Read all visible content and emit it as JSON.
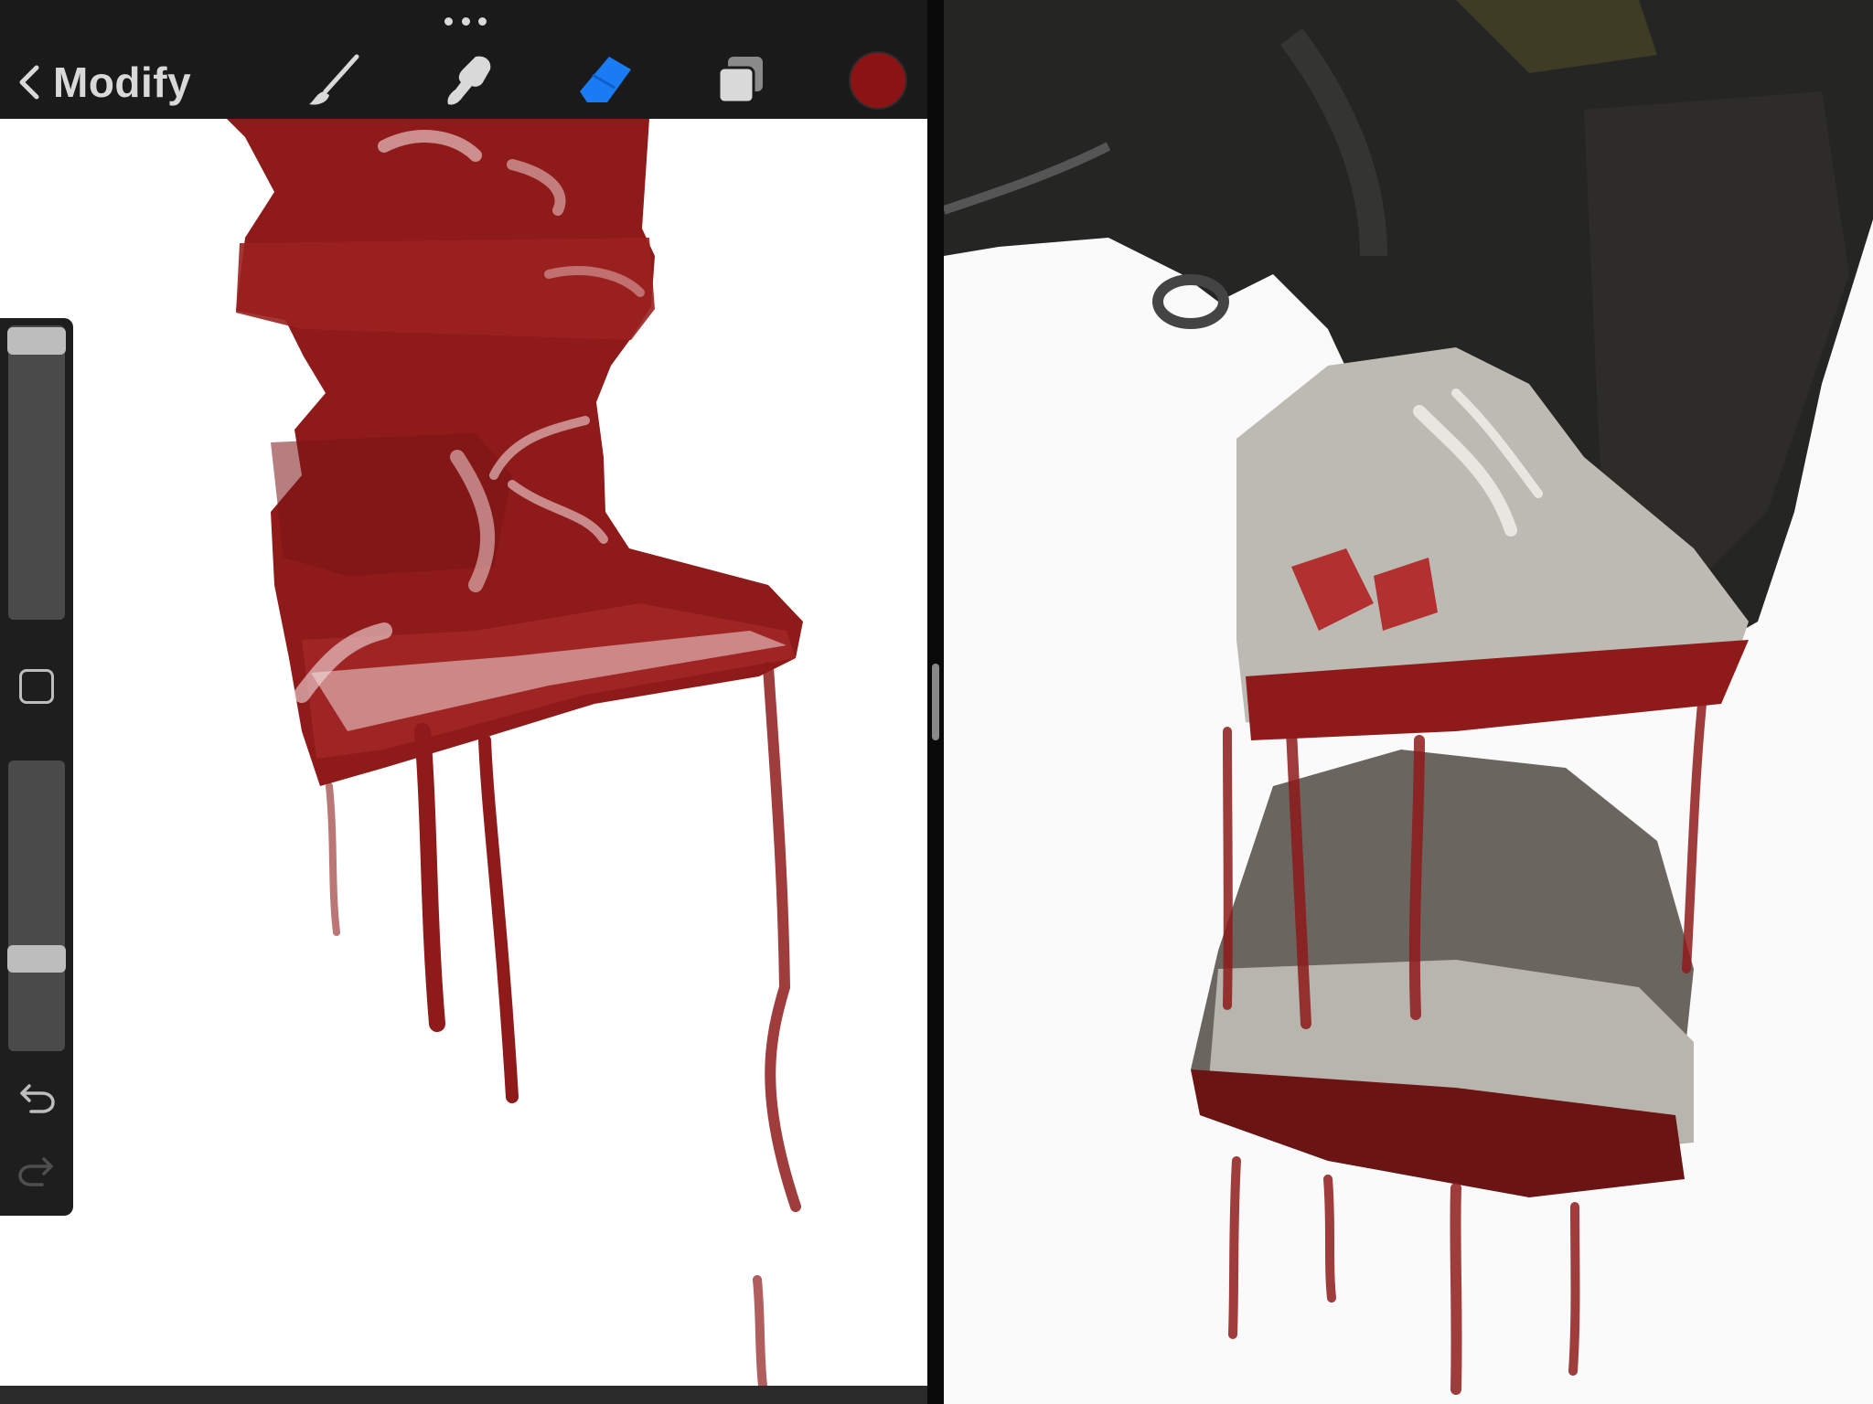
{
  "toolbar": {
    "back_label": "Modify",
    "tools": [
      {
        "name": "brush",
        "icon": "brush-icon",
        "active": false
      },
      {
        "name": "smudge",
        "icon": "smudge-icon",
        "active": false
      },
      {
        "name": "eraser",
        "icon": "eraser-icon",
        "active": true
      },
      {
        "name": "layers",
        "icon": "layers-icon",
        "active": false
      }
    ],
    "current_color": "#8c1313",
    "active_tool_color": "#1a7cf5",
    "inactive_tool_color": "#d9d9d9"
  },
  "sidebar": {
    "brush_size_level": 0.98,
    "opacity_level": 0.35,
    "icons": [
      "modify-square-icon",
      "undo-icon",
      "redo-icon"
    ]
  },
  "colors": {
    "paint_red": "#8e1a1a",
    "pants_dark": "#2a2a28",
    "shoe_light": "#bdbab3"
  }
}
